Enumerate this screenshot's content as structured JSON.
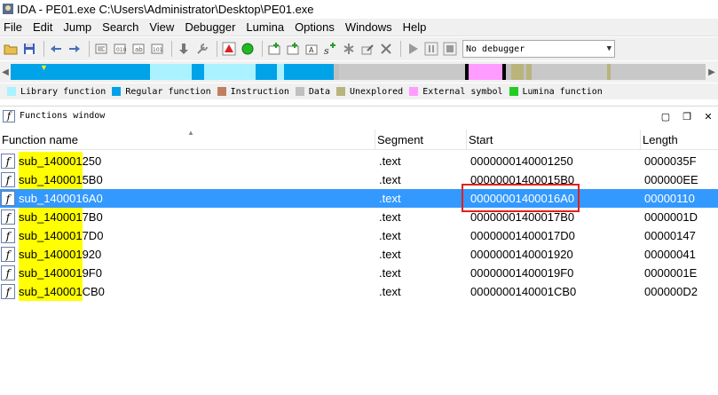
{
  "window": {
    "title": "IDA - PE01.exe C:\\Users\\Administrator\\Desktop\\PE01.exe"
  },
  "menu": [
    "File",
    "Edit",
    "Jump",
    "Search",
    "View",
    "Debugger",
    "Lumina",
    "Options",
    "Windows",
    "Help"
  ],
  "toolbar": {
    "debugger_value": "No debugger"
  },
  "legend": [
    {
      "label": "Library function",
      "color": "#aaf2ff"
    },
    {
      "label": "Regular function",
      "color": "#00a2e8"
    },
    {
      "label": "Instruction",
      "color": "#c08060"
    },
    {
      "label": "Data",
      "color": "#c0c0c0"
    },
    {
      "label": "Unexplored",
      "color": "#b8b47c"
    },
    {
      "label": "External symbol",
      "color": "#ff9cff"
    },
    {
      "label": "Lumina function",
      "color": "#22cc22"
    }
  ],
  "functions_window": {
    "title": "Functions window",
    "columns": [
      "Function name",
      "Segment",
      "Start",
      "Length"
    ],
    "rows": [
      {
        "name_prefix": "sub_140001",
        "name_suffix": "250",
        "segment": ".text",
        "start": "0000000140001250",
        "length": "0000035F",
        "selected": false
      },
      {
        "name_prefix": "sub_140001",
        "name_suffix": "5B0",
        "segment": ".text",
        "start": "00000001400015B0",
        "length": "000000EE",
        "selected": false
      },
      {
        "name_prefix": "sub_140001",
        "name_suffix": "6A0",
        "segment": ".text",
        "start": "00000001400016A0",
        "length": "00000110",
        "selected": true
      },
      {
        "name_prefix": "sub_140001",
        "name_suffix": "7B0",
        "segment": ".text",
        "start": "00000001400017B0",
        "length": "0000001D",
        "selected": false
      },
      {
        "name_prefix": "sub_140001",
        "name_suffix": "7D0",
        "segment": ".text",
        "start": "00000001400017D0",
        "length": "00000147",
        "selected": false
      },
      {
        "name_prefix": "sub_140001",
        "name_suffix": "920",
        "segment": ".text",
        "start": "0000000140001920",
        "length": "00000041",
        "selected": false
      },
      {
        "name_prefix": "sub_140001",
        "name_suffix": "9F0",
        "segment": ".text",
        "start": "00000001400019F0",
        "length": "0000001E",
        "selected": false
      },
      {
        "name_prefix": "sub_140001",
        "name_suffix": "CB0",
        "segment": ".text",
        "start": "0000000140001CB0",
        "length": "000000D2",
        "selected": false
      }
    ]
  }
}
